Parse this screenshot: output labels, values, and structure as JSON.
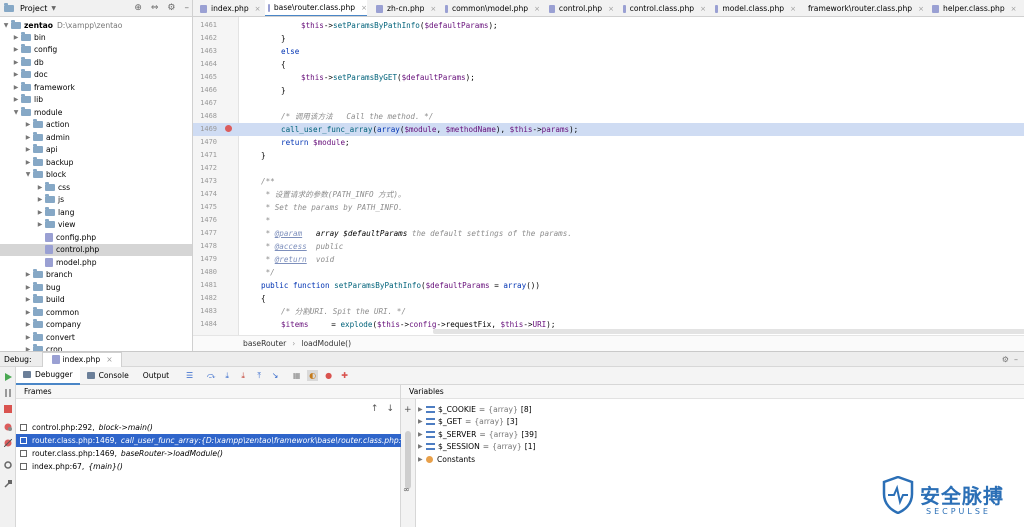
{
  "project": {
    "title": "Project",
    "root_name": "zentao",
    "root_path": "D:\\xampp\\zentao",
    "items": [
      "bin",
      "config",
      "db",
      "doc",
      "framework",
      "lib",
      "module",
      "action",
      "admin",
      "api",
      "backup",
      "block",
      "css",
      "js",
      "lang",
      "view",
      "config.php",
      "control.php",
      "model.php",
      "branch",
      "bug",
      "build",
      "common",
      "company",
      "convert",
      "cron"
    ]
  },
  "tabs": [
    "index.php",
    "base\\router.class.php",
    "zh-cn.php",
    "common\\model.php",
    "control.php",
    "control.class.php",
    "model.class.php",
    "framework\\router.class.php",
    "helper.class.php"
  ],
  "editor": {
    "line_numbers": [
      "1461",
      "1462",
      "1463",
      "1464",
      "1465",
      "1466",
      "1467",
      "1468",
      "1469",
      "1470",
      "1471",
      "1472",
      "1473",
      "1474",
      "1475",
      "1476",
      "1477",
      "1478",
      "1479",
      "1480",
      "1481",
      "1482",
      "1483",
      "1484"
    ],
    "current_line": "1469",
    "lines": [
      "$this->setParamsByPathInfo($defaultParams);",
      "}",
      "else",
      "{",
      "$this->setParamsByGET($defaultParams);",
      "}",
      "",
      "/* 调用该方法   Call the method. */",
      "call_user_func_array(array($module, $methodName), $this->params);",
      "return $module;",
      "}",
      "",
      "/**",
      " * 设置请求的参数(PATH_INFO 方式)。",
      " * Set the params by PATH_INFO.",
      " *",
      " * @param   array $defaultParams the default settings of the params.",
      " * @access  public",
      " * @return  void",
      " */",
      "public function setParamsByPathInfo($defaultParams = array())",
      "{",
      "/* 分割URI. Spit the URI. */",
      "$items     = explode($this->config->requestFix, $this->URI);"
    ]
  },
  "breadcrumb": [
    "baseRouter",
    "loadModule()"
  ],
  "debug": {
    "label": "Debug:",
    "session": "index.php",
    "tabs": [
      "Debugger",
      "Console",
      "Output"
    ],
    "frames_header": "Frames",
    "frames": [
      {
        "location": "control.php:292,",
        "method": "block->main()"
      },
      {
        "location": "router.class.php:1469,",
        "method": "call_user_func_array:{D:\\xampp\\zentao\\framework\\base\\router.class.php:1469}()"
      },
      {
        "location": "router.class.php:1469,",
        "method": "baseRouter->loadModule()"
      },
      {
        "location": "index.php:67,",
        "method": "{main}()"
      }
    ],
    "variables_header": "Variables",
    "variables": [
      {
        "name": "$_COOKIE",
        "type": "{array}",
        "count": "[8]"
      },
      {
        "name": "$_GET",
        "type": "{array}",
        "count": "[3]"
      },
      {
        "name": "$_SERVER",
        "type": "{array}",
        "count": "[39]"
      },
      {
        "name": "$_SESSION",
        "type": "{array}",
        "count": "[1]"
      },
      {
        "name": "Constants",
        "type": "",
        "count": ""
      }
    ]
  },
  "watermark": {
    "text": "安全脉搏",
    "sub": "SECPULSE"
  },
  "colors": {
    "accent": "#2f65ca",
    "current_line": "#cfdcf3",
    "breakpoint": "#db5c5c",
    "keyword": "#0033b3",
    "variable": "#660e7a"
  }
}
